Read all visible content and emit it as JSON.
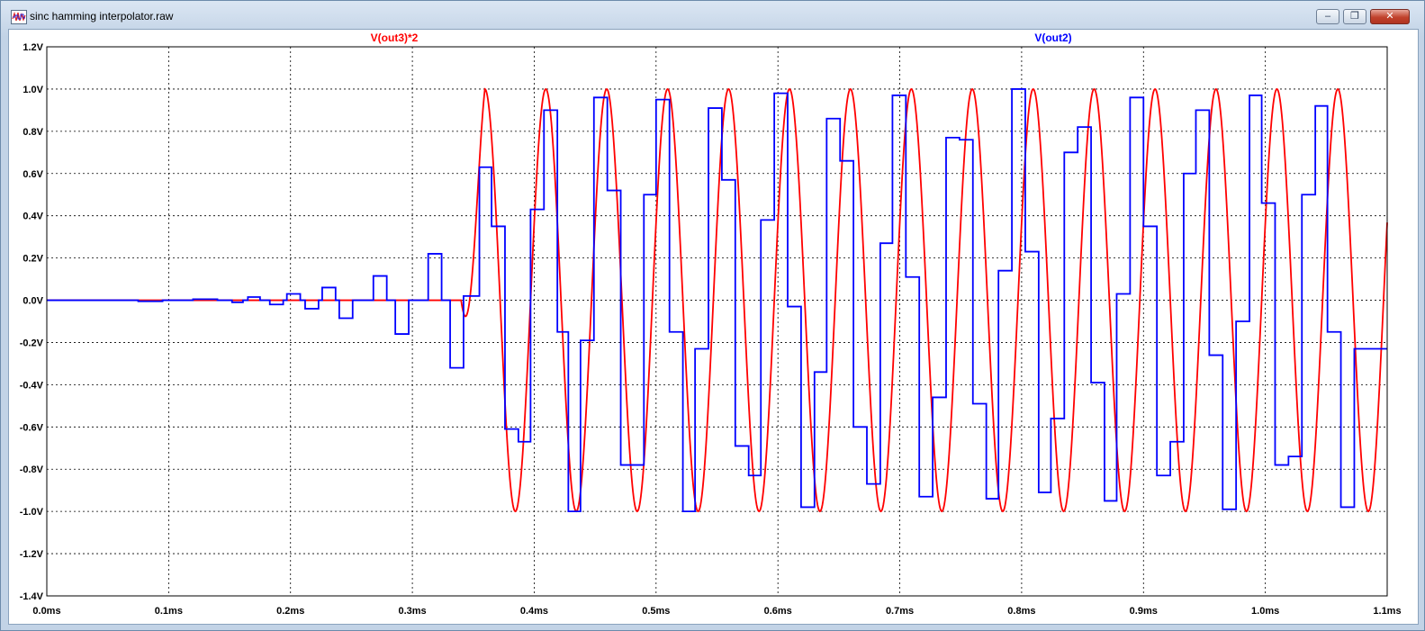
{
  "window": {
    "title": "sinc hamming interpolator.raw",
    "icon": "waveform-viewer-icon",
    "buttons": {
      "minimize_label": "–",
      "restore_label": "❐",
      "close_label": "✕"
    }
  },
  "colors": {
    "out3_series": "#ff0000",
    "out2_series": "#0000ff",
    "grid": "#000000",
    "background": "#ffffff"
  },
  "chart_data": {
    "type": "line",
    "title": "",
    "xlabel": "",
    "ylabel": "",
    "grid": true,
    "grid_style": "dashed",
    "xlim": [
      0,
      1.1
    ],
    "ylim": [
      -1.4,
      1.2
    ],
    "x_unit": "ms",
    "y_unit": "V",
    "x_ticks": [
      0,
      0.1,
      0.2,
      0.3,
      0.4,
      0.5,
      0.6,
      0.7,
      0.8,
      0.9,
      1.0,
      1.1
    ],
    "x_tick_labels": [
      "0.0ms",
      "0.1ms",
      "0.2ms",
      "0.3ms",
      "0.4ms",
      "0.5ms",
      "0.6ms",
      "0.7ms",
      "0.8ms",
      "0.9ms",
      "1.0ms",
      "1.1ms"
    ],
    "y_ticks": [
      1.2,
      1.0,
      0.8,
      0.6,
      0.4,
      0.2,
      0.0,
      -0.2,
      -0.4,
      -0.6,
      -0.8,
      -1.0,
      -1.2,
      -1.4
    ],
    "y_tick_labels": [
      "1.2V",
      "1.0V",
      "0.8V",
      "0.6V",
      "0.4V",
      "0.2V",
      "0.0V",
      "-0.2V",
      "-0.4V",
      "-0.6V",
      "-0.8V",
      "-1.0V",
      "-1.2V",
      "-1.4V"
    ],
    "series": [
      {
        "name": "V(out3)*2",
        "color": "#ff0000",
        "legend_position": "top-left",
        "style": "smooth",
        "onset_ms": 0.34,
        "period_ms": 0.05,
        "first_peak_ms": 0.3595,
        "amplitude": 1.0,
        "points": [
          [
            0.0,
            0.0
          ],
          [
            0.34,
            0.0
          ],
          [
            0.3595,
            1.0
          ],
          [
            0.3845,
            -1.0
          ],
          [
            0.4095,
            1.0
          ],
          [
            0.4345,
            -1.0
          ],
          [
            0.4595,
            1.0
          ],
          [
            0.4845,
            -1.0
          ],
          [
            0.5095,
            1.0
          ],
          [
            0.5345,
            -1.0
          ],
          [
            0.5595,
            1.0
          ],
          [
            0.5845,
            -1.0
          ],
          [
            0.6095,
            1.0
          ],
          [
            0.6345,
            -1.0
          ],
          [
            0.6595,
            1.0
          ],
          [
            0.6845,
            -1.0
          ],
          [
            0.7095,
            1.0
          ],
          [
            0.7345,
            -1.0
          ],
          [
            0.7595,
            1.0
          ],
          [
            0.7845,
            -1.0
          ],
          [
            0.8095,
            1.0
          ],
          [
            0.8345,
            -1.0
          ],
          [
            0.8595,
            1.0
          ],
          [
            0.8845,
            -1.0
          ],
          [
            0.9095,
            1.0
          ],
          [
            0.9345,
            -1.0
          ],
          [
            0.9595,
            1.0
          ],
          [
            0.9845,
            -1.0
          ],
          [
            1.0095,
            1.0
          ],
          [
            1.0345,
            -1.0
          ],
          [
            1.0595,
            1.0
          ],
          [
            1.0845,
            -1.0
          ],
          [
            1.1,
            0.45
          ]
        ]
      },
      {
        "name": "V(out2)",
        "color": "#0000ff",
        "legend_position": "top-right",
        "style": "step",
        "steps": [
          [
            0.0,
            0.0
          ],
          [
            0.075,
            -0.005
          ],
          [
            0.095,
            0.0
          ],
          [
            0.12,
            0.005
          ],
          [
            0.14,
            0.0
          ],
          [
            0.12,
            0.005
          ],
          [
            0.143,
            0.0
          ],
          [
            0.152,
            -0.01
          ],
          [
            0.161,
            0.0
          ],
          [
            0.14,
            0.0
          ],
          [
            0.143,
            0.0
          ],
          [
            0.152,
            -0.01
          ],
          [
            0.161,
            0.0
          ],
          [
            0.165,
            0.015
          ],
          [
            0.175,
            0.0
          ],
          [
            0.183,
            -0.02
          ],
          [
            0.194,
            0.0
          ],
          [
            0.197,
            0.03
          ],
          [
            0.208,
            0.0
          ],
          [
            0.212,
            -0.04
          ],
          [
            0.223,
            0.0
          ],
          [
            0.226,
            0.06
          ],
          [
            0.237,
            0.0
          ],
          [
            0.24,
            -0.085
          ],
          [
            0.251,
            0.0
          ],
          [
            0.268,
            0.115
          ],
          [
            0.279,
            0.0
          ],
          [
            0.286,
            -0.16
          ],
          [
            0.297,
            0.0
          ],
          [
            0.313,
            0.22
          ],
          [
            0.324,
            0.0
          ],
          [
            0.331,
            -0.32
          ],
          [
            0.342,
            0.02
          ],
          [
            0.355,
            0.63
          ],
          [
            0.365,
            0.35
          ],
          [
            0.376,
            -0.61
          ],
          [
            0.387,
            -0.67
          ],
          [
            0.397,
            0.43
          ],
          [
            0.408,
            0.9
          ],
          [
            0.419,
            -0.15
          ],
          [
            0.428,
            -1.0
          ],
          [
            0.438,
            -0.19
          ],
          [
            0.449,
            0.96
          ],
          [
            0.46,
            0.52
          ],
          [
            0.471,
            -0.78
          ],
          [
            0.49,
            0.5
          ],
          [
            0.5,
            0.95
          ],
          [
            0.511,
            -0.15
          ],
          [
            0.522,
            -1.0
          ],
          [
            0.532,
            -0.23
          ],
          [
            0.543,
            0.91
          ],
          [
            0.554,
            0.57
          ],
          [
            0.565,
            -0.69
          ],
          [
            0.576,
            -0.83
          ],
          [
            0.586,
            0.38
          ],
          [
            0.597,
            0.98
          ],
          [
            0.608,
            -0.03
          ],
          [
            0.619,
            -0.98
          ],
          [
            0.63,
            -0.34
          ],
          [
            0.64,
            0.86
          ],
          [
            0.651,
            0.66
          ],
          [
            0.662,
            -0.6
          ],
          [
            0.673,
            -0.87
          ],
          [
            0.684,
            0.27
          ],
          [
            0.694,
            0.97
          ],
          [
            0.705,
            0.11
          ],
          [
            0.716,
            -0.93
          ],
          [
            0.727,
            -0.46
          ],
          [
            0.738,
            0.77
          ],
          [
            0.749,
            0.76
          ],
          [
            0.76,
            -0.49
          ],
          [
            0.771,
            -0.94
          ],
          [
            0.781,
            0.14
          ],
          [
            0.792,
            1.0
          ],
          [
            0.803,
            0.23
          ],
          [
            0.814,
            -0.91
          ],
          [
            0.824,
            -0.56
          ],
          [
            0.835,
            0.7
          ],
          [
            0.846,
            0.82
          ],
          [
            0.857,
            -0.39
          ],
          [
            0.868,
            -0.95
          ],
          [
            0.878,
            0.03
          ],
          [
            0.889,
            0.96
          ],
          [
            0.9,
            0.35
          ],
          [
            0.911,
            -0.83
          ],
          [
            0.922,
            -0.67
          ],
          [
            0.933,
            0.6
          ],
          [
            0.943,
            0.9
          ],
          [
            0.954,
            -0.26
          ],
          [
            0.965,
            -0.99
          ],
          [
            0.976,
            -0.1
          ],
          [
            0.987,
            0.97
          ],
          [
            0.997,
            0.46
          ],
          [
            1.008,
            -0.78
          ],
          [
            1.019,
            -0.74
          ],
          [
            1.03,
            0.5
          ],
          [
            1.041,
            0.92
          ],
          [
            1.051,
            -0.15
          ],
          [
            1.062,
            -0.98
          ],
          [
            1.073,
            -0.23
          ]
        ]
      }
    ]
  }
}
